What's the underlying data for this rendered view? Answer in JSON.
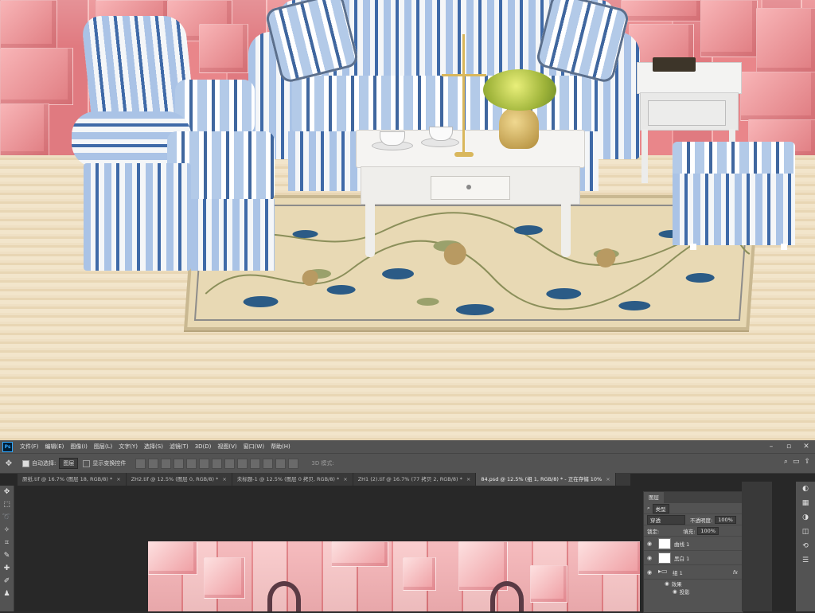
{
  "app": {
    "name": "Photoshop",
    "logo_text": "Ps"
  },
  "menu": [
    "文件(F)",
    "编辑(E)",
    "图像(I)",
    "图层(L)",
    "文字(Y)",
    "选择(S)",
    "滤镜(T)",
    "3D(D)",
    "视图(V)",
    "窗口(W)",
    "帮助(H)"
  ],
  "options": {
    "auto_select_label": "自动选择:",
    "auto_select_value": "图层",
    "transform_label": "显示变换控件",
    "mode_3d": "3D 模式:"
  },
  "tabs": [
    {
      "label": "原纸.tif @ 16.7% (图层 18, RGB/8) *",
      "active": false
    },
    {
      "label": "ZH2.tif @ 12.5% (图层 0, RGB/8) *",
      "active": false
    },
    {
      "label": "未标题-1 @ 12.5% (图层 0 拷贝, RGB/8) *",
      "active": false
    },
    {
      "label": "ZH1 (2).tif @ 16.7% (77 拷贝 2, RGB/8) *",
      "active": false
    },
    {
      "label": "84.psd @ 12.5% (组 1, RGB/8) * - 正在存储 10%",
      "active": true
    }
  ],
  "layers_panel": {
    "tab": "图层",
    "filter_kind": "类型",
    "blend_mode": "穿透",
    "opacity_label": "不透明度:",
    "opacity_value": "100%",
    "lock_label": "锁定:",
    "fill_label": "填充:",
    "fill_value": "100%",
    "layers": [
      {
        "name": "曲线 1",
        "type": "adjustment"
      },
      {
        "name": "黑白 1",
        "type": "adjustment"
      },
      {
        "name": "组 1",
        "type": "group",
        "fx": "fx"
      }
    ],
    "effects": [
      "效果",
      "投影"
    ]
  },
  "colors": {
    "wall_pink": "#e98a8e",
    "floor": "#efe0c4",
    "stripe_blue": "#3f6aa8",
    "stripe_light": "#aac3e6",
    "ps_dark": "#282828",
    "ps_panel": "#535353"
  }
}
